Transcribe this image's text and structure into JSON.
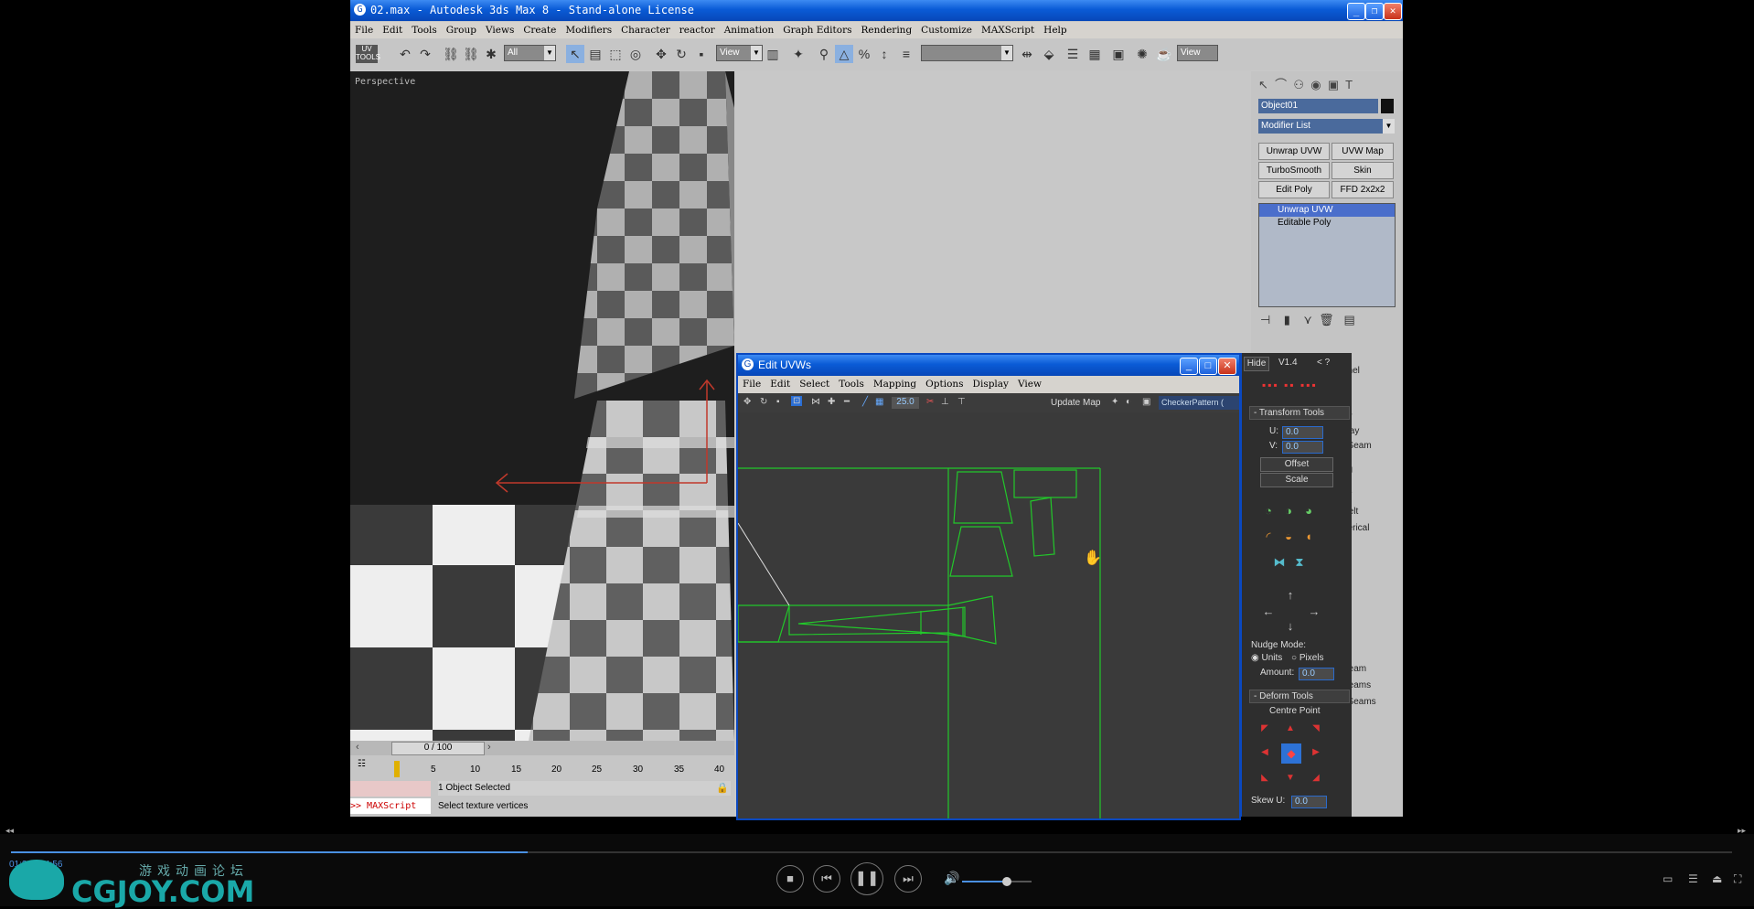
{
  "max_window": {
    "title": "02.max - Autodesk 3ds Max 8 - Stand-alone License",
    "menu": [
      "File",
      "Edit",
      "Tools",
      "Group",
      "Views",
      "Create",
      "Modifiers",
      "Character",
      "reactor",
      "Animation",
      "Graph Editors",
      "Rendering",
      "Customize",
      "MAXScript",
      "Help"
    ],
    "toolbar": {
      "uv_tools_label": "UV\nTOOLS",
      "selection_filter": "All",
      "ref_coord": "View",
      "named_selection": "",
      "right_view": "View"
    },
    "viewport_label": "Perspective"
  },
  "command_panel": {
    "object_name": "Object01",
    "modifier_list": "Modifier List",
    "buttons": [
      "Unwrap UVW",
      "UVW Map",
      "TurboSmooth",
      "Skin",
      "Edit Poly",
      "FFD 2x2x2"
    ],
    "stack": [
      "Unwrap UVW",
      "Editable Poly"
    ],
    "partial_labels": [
      "nnel",
      "ay",
      "play",
      "t Seam",
      "ng",
      "es",
      "Pelt",
      "herical",
      "Seam",
      "Seams",
      "t Seams"
    ]
  },
  "uvw_window": {
    "title": "Edit UVWs",
    "menu": [
      "File",
      "Edit",
      "Select",
      "Tools",
      "Mapping",
      "Options",
      "Display",
      "View"
    ],
    "zoom_value": "25.0",
    "update_map": "Update Map",
    "map_dropdown": "CheckerPattern  ("
  },
  "rollout": {
    "hide": "Hide",
    "version": "V1.4",
    "nav": "< ?",
    "transform_tools": "- Transform Tools",
    "u_label": "U:",
    "u_value": "0.0",
    "v_label": "V:",
    "v_value": "0.0",
    "offset": "Offset",
    "scale": "Scale",
    "nudge_mode": "Nudge Mode:",
    "units": "Units",
    "pixels": "Pixels",
    "amount_label": "Amount:",
    "amount_value": "0.0",
    "deform_tools": "- Deform Tools",
    "centre_point": "Centre Point",
    "skew_label": "Skew U:",
    "skew_value": "0.0"
  },
  "timeline": {
    "frame_counter": "0 / 100",
    "ticks": [
      "5",
      "10",
      "15",
      "20",
      "25",
      "30",
      "35",
      "40"
    ],
    "status_selected": "1 Object Selected",
    "status_prompt": "Select texture vertices",
    "maxscript": ">> MAXScript"
  },
  "player": {
    "time": "01:21 / 24:56",
    "progress": 0.3,
    "volume": 0.65,
    "logo_top": "游戏动画论坛",
    "logo_main": "CGJOY.COM"
  },
  "colors": {
    "uv_lines": "#22c82a",
    "xp_title": "#0a5bd6",
    "selection": "#4a6ecb"
  }
}
